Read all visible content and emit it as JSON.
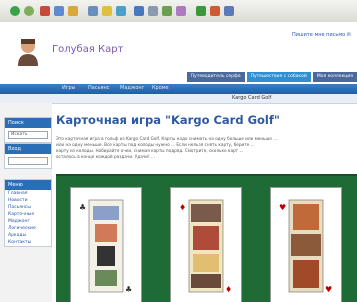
{
  "site": {
    "title": "Голубая Карт",
    "top_links": "Пишите мне письмо ✉",
    "top_tabs": [
      "Путеводитель серфа",
      "Путешествия с собакой",
      "Моя коллекция"
    ]
  },
  "nav": {
    "items": [
      "Игры",
      "Пасьянс",
      "Маджонг",
      "Кроме"
    ],
    "breadcrumb": "Kargo Card Golf"
  },
  "sidebar": {
    "search_head": "Поиск",
    "search_placeholder": "Искать",
    "login_head": "Вход",
    "links_head": "Меню",
    "links": [
      "Главная",
      "Новости",
      "Пасьянсы",
      "Карточные",
      "Маджонг",
      "Логические",
      "Аркады",
      "Контакты"
    ]
  },
  "main": {
    "title": "Карточная игра \"Kargo Card Golf\"",
    "paragraph_lines": [
      "Это карточная игра в гольф из Kargo Card Golf. Карты надо снимать на одну больше или меньше ...",
      "или на одну меньше. Все карты под колоды нужно ... Если нельзя снять карту, берите ...",
      "карту из колоды. Набирайте очки, снимая карты подряд. Смотрите, сколько карт ...",
      "осталось в конце каждой раздачи. Удачи! ..."
    ]
  },
  "colors": {
    "nav_blue": "#1f5ea3",
    "title_blue": "#2a5aa5",
    "board_green": "#1f6b35",
    "site_title_purple": "#7b5aa8"
  }
}
